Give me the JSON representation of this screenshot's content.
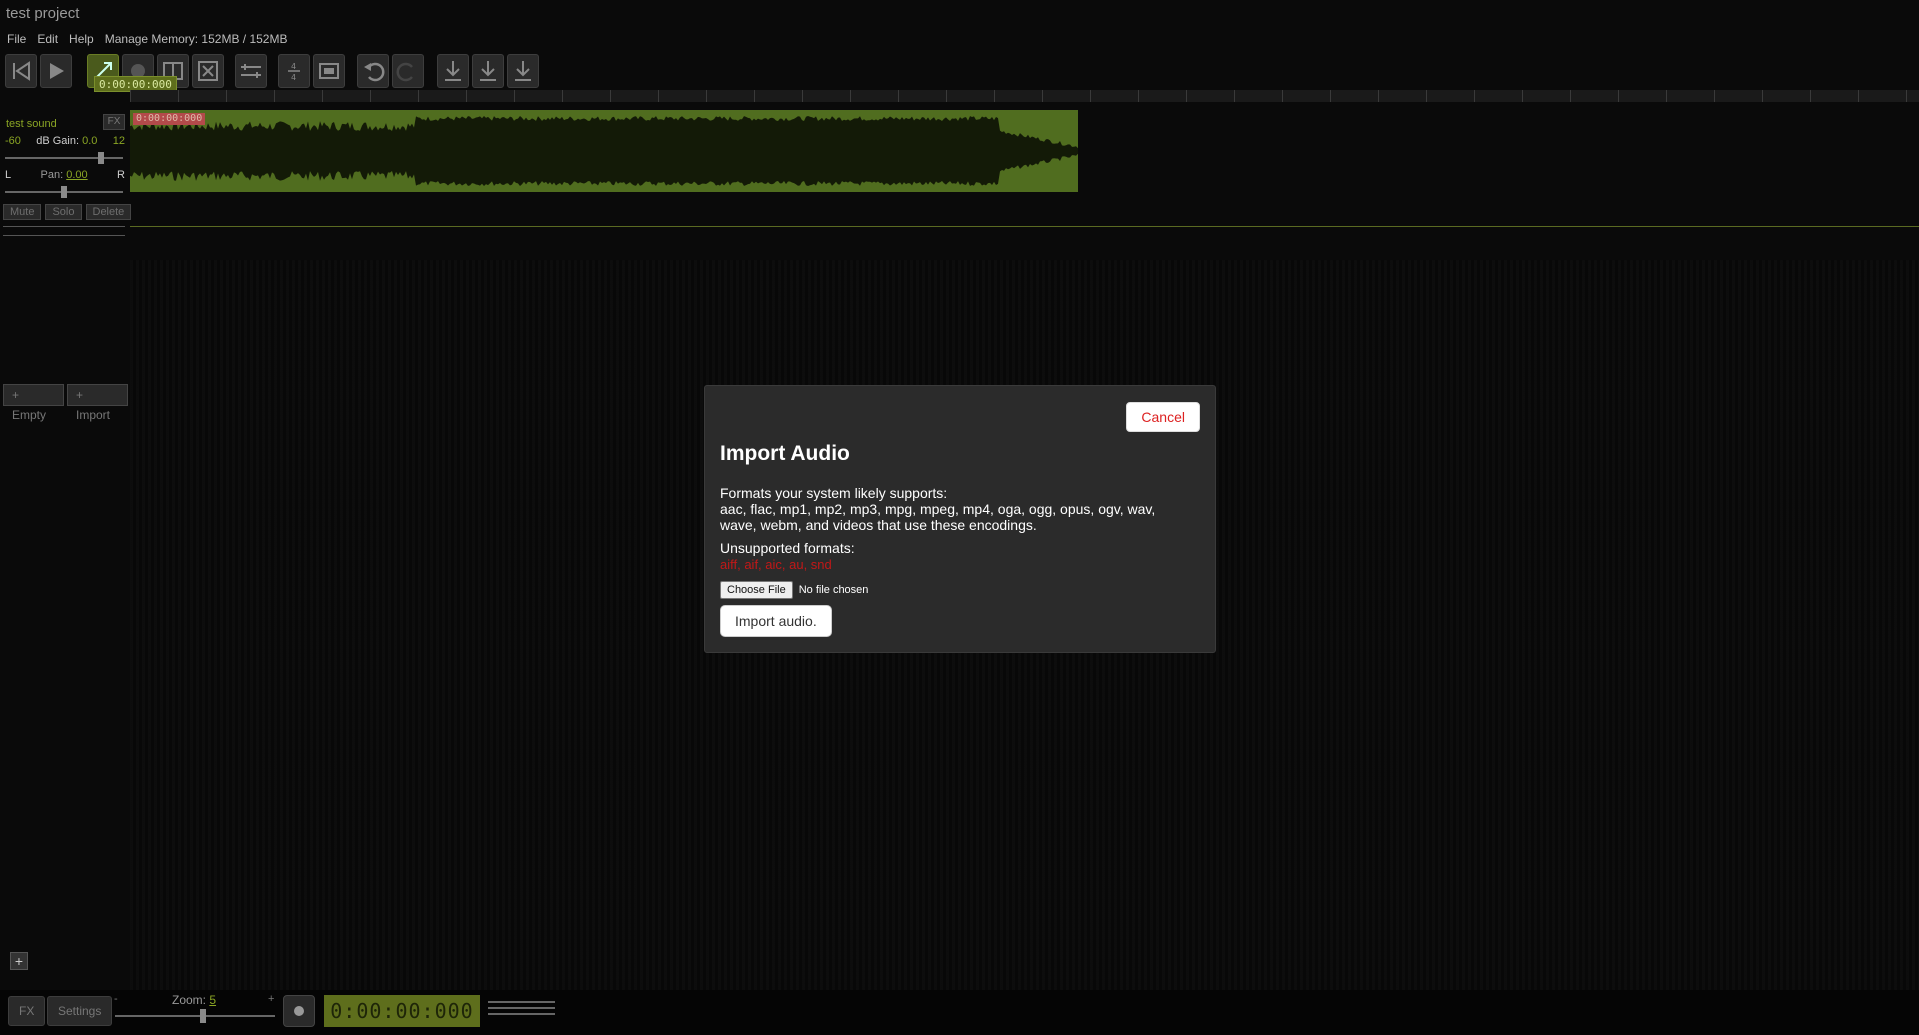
{
  "app": {
    "title": "test project"
  },
  "menu": {
    "file": "File",
    "edit": "Edit",
    "help": "Help",
    "memory": "Manage Memory: 152MB / 152MB"
  },
  "toolbar": {
    "cursor_time": "0:00:00:000",
    "icons": [
      "skip-back-icon",
      "play-icon",
      "select-tool-icon",
      "record-tool-icon",
      "split-icon",
      "delete-icon",
      "arrange-icon",
      "tempo-icon",
      "video-icon",
      "undo-icon",
      "redo-icon",
      "export-wav-icon",
      "export-mp3-icon",
      "download-icon"
    ]
  },
  "track": {
    "name": "test sound",
    "fx_label": "FX",
    "gain_min": "-60",
    "gain_label": "dB Gain:",
    "gain_value": "0.0",
    "gain_max": "12",
    "gain_level": 0.83,
    "pan_left": "L",
    "pan_label": "Pan:",
    "pan_value": "0.00",
    "pan_right": "R",
    "pan_level": 0.5,
    "mute": "Mute",
    "solo": "Solo",
    "delete": "Delete",
    "clip_label": "0:00:00:000"
  },
  "add": {
    "empty": "+ Empty",
    "import": "+ Import"
  },
  "bottom": {
    "fx": "FX",
    "settings": "Settings",
    "zoom_label": "Zoom:",
    "zoom_value": "5",
    "zoom_minus": "-",
    "zoom_plus": "+",
    "time": "0:00:00:000"
  },
  "dialog": {
    "cancel": "Cancel",
    "title": "Import Audio",
    "formats_heading": "Formats your system likely supports:",
    "formats_list": "aac, flac, mp1, mp2, mp3, mpg, mpeg, mp4, oga, ogg, opus, ogv, wav, wave, webm, and videos that use these encodings.",
    "unsupported_heading": "Unsupported formats:",
    "unsupported_list": "aiff, aif, aic, au, snd",
    "choose_file": "Choose File",
    "no_file": "No file chosen",
    "import_button": "Import audio."
  },
  "colors": {
    "accent": "#8aa524",
    "clip": "#506d1f",
    "danger": "#c21818"
  }
}
